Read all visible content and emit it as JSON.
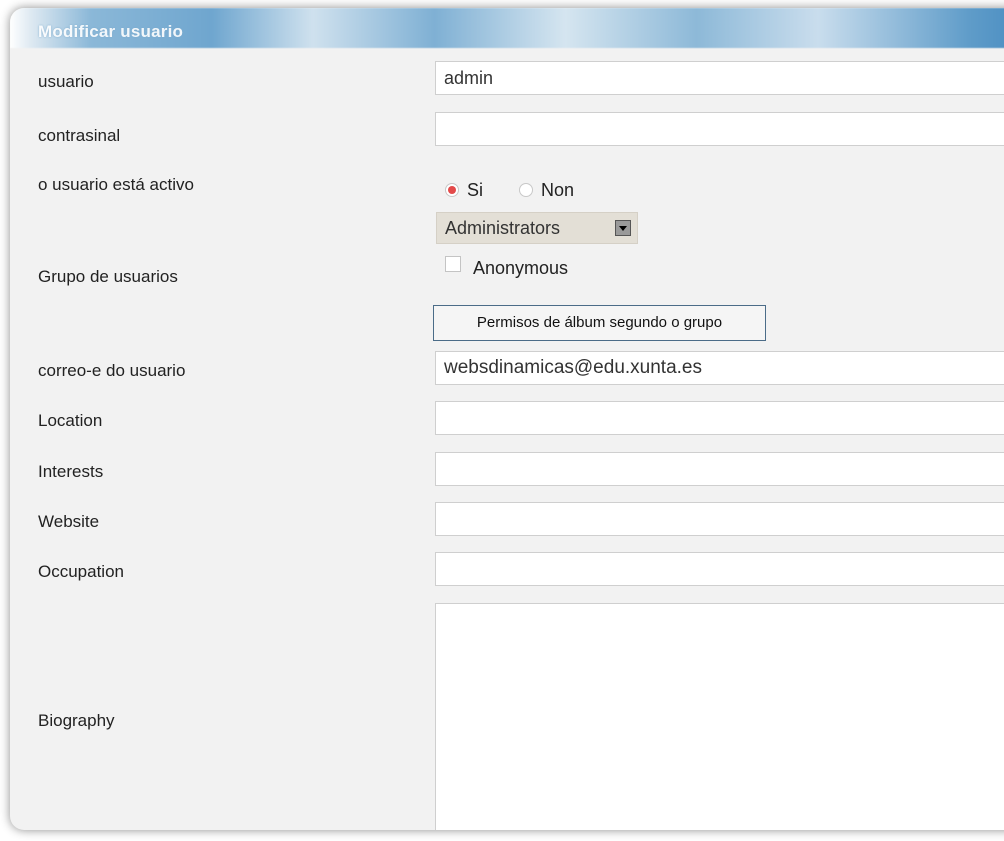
{
  "form": {
    "title": "Modificar usuario",
    "fields": {
      "usuario": {
        "label": "usuario",
        "value": "admin"
      },
      "contrasinal": {
        "label": "contrasinal",
        "value": ""
      },
      "activo": {
        "label": "o usuario está activo",
        "options": [
          "Si",
          "Non"
        ],
        "selected": "Si"
      },
      "grupo": {
        "label": "Grupo de usuarios",
        "selected": "Administrators",
        "checkbox_label": "Anonymous",
        "checkbox_checked": false,
        "button_label": "Permisos de álbum segundo o grupo"
      },
      "correo": {
        "label": "correo-e do usuario",
        "value": "websdinamicas@edu.xunta.es"
      },
      "location": {
        "label": "Location",
        "value": ""
      },
      "interests": {
        "label": "Interests",
        "value": ""
      },
      "website": {
        "label": "Website",
        "value": ""
      },
      "occupation": {
        "label": "Occupation",
        "value": ""
      },
      "biography": {
        "label": "Biography",
        "value": ""
      }
    }
  },
  "colors": {
    "panel_bg": "#f2f2f2",
    "radio_selected": "#e34a4a",
    "title_bar": "#6fa6cf"
  }
}
